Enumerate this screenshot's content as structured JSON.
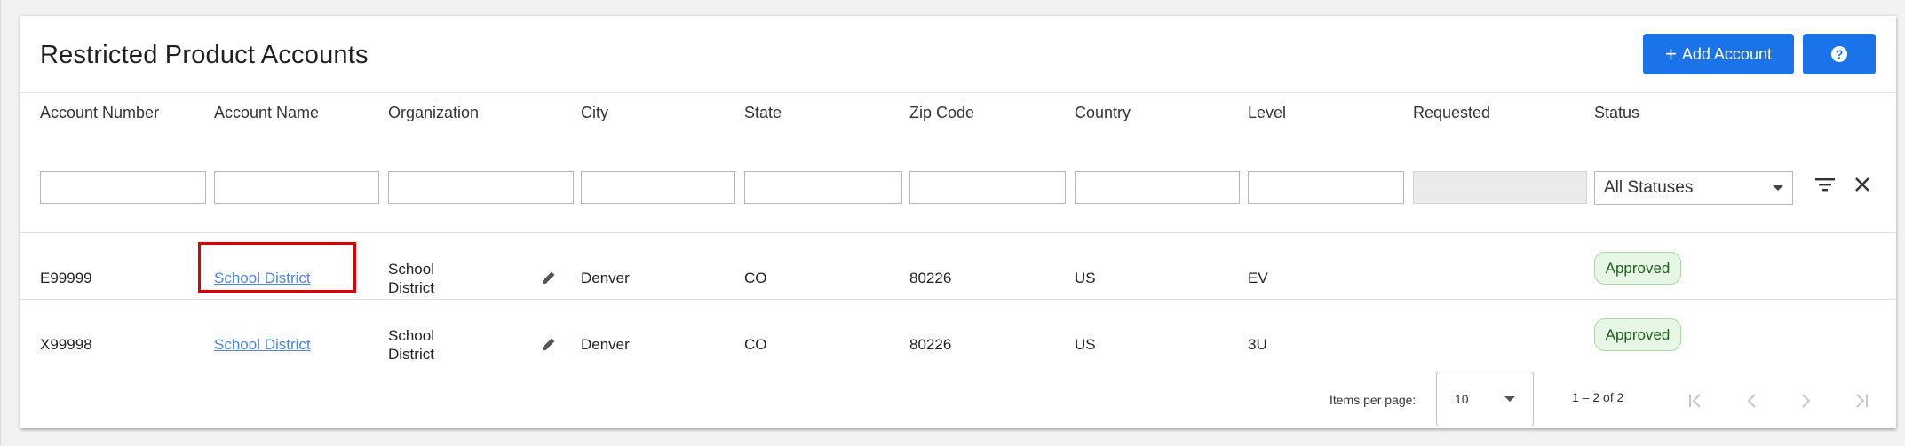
{
  "page": {
    "title": "Restricted Product Accounts",
    "add_button_label": "Add Account",
    "help_icon": "help-icon"
  },
  "table": {
    "columns": [
      "Account Number",
      "Account Name",
      "Organization",
      "City",
      "State",
      "Zip Code",
      "Country",
      "Level",
      "Requested",
      "Status"
    ],
    "status_filter_value": "All Statuses",
    "rows": [
      {
        "account_number": "E99999",
        "account_name": "School District",
        "organization_line1": "School",
        "organization_line2": "District",
        "city": "Denver",
        "state": "CO",
        "zip": "80226",
        "country": "US",
        "level": "EV",
        "status": "Approved"
      },
      {
        "account_number": "X99998",
        "account_name": "School District",
        "organization_line1": "School",
        "organization_line2": "District",
        "city": "Denver",
        "state": "CO",
        "zip": "80226",
        "country": "US",
        "level": "3U",
        "status": "Approved"
      }
    ]
  },
  "pagination": {
    "items_per_page_label": "Items per page:",
    "items_per_page_value": "10",
    "range_label": "1 – 2 of 2"
  },
  "colors": {
    "accent": "#1a73e8",
    "link": "#4a86e8",
    "highlight": "#e00000",
    "approved_bg": "#e6f7e6"
  }
}
